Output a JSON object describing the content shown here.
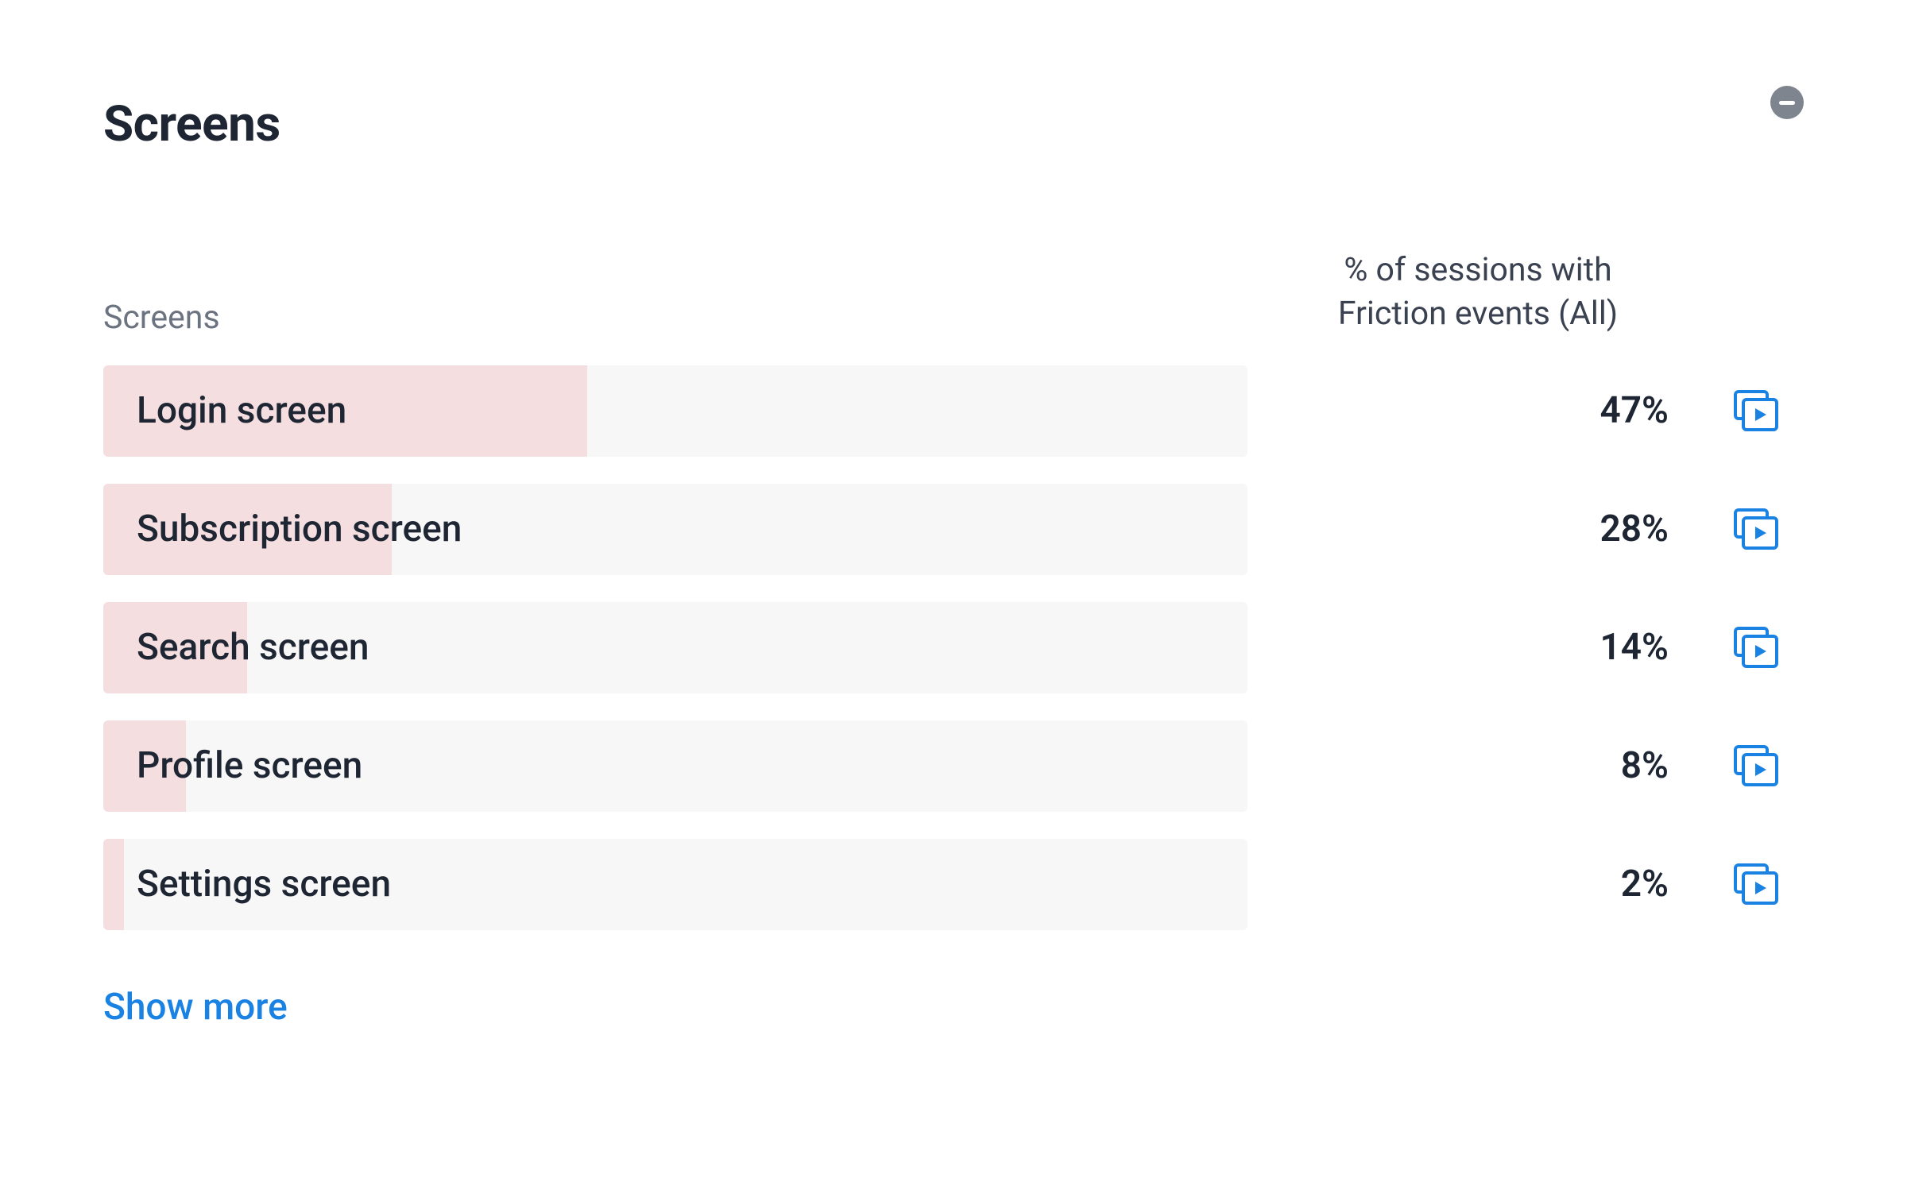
{
  "panel": {
    "title": "Screens",
    "columns": {
      "name_label": "Screens",
      "pct_label_line1": "% of sessions with",
      "pct_label_line2": "Friction events (All)"
    },
    "rows": [
      {
        "name": "Login screen",
        "pct_label": "47%",
        "pct": 47
      },
      {
        "name": "Subscription screen",
        "pct_label": "28%",
        "pct": 28
      },
      {
        "name": "Search screen",
        "pct_label": "14%",
        "pct": 14
      },
      {
        "name": "Profile screen",
        "pct_label": "8%",
        "pct": 8
      },
      {
        "name": "Settings screen",
        "pct_label": "2%",
        "pct": 2
      }
    ],
    "show_more_label": "Show more"
  },
  "colors": {
    "bar_track": "#f7f7f8",
    "bar_fill": "#f5dedf",
    "accent_link": "#1a82e2",
    "icon_blue": "#1a82e2",
    "text_primary": "#1f2633",
    "text_muted": "#6b7380",
    "collapse_bg": "#7e858f"
  },
  "chart_data": {
    "type": "bar",
    "title": "Screens",
    "xlabel": "",
    "ylabel": "% of sessions with Friction events (All)",
    "categories": [
      "Login screen",
      "Subscription screen",
      "Search screen",
      "Profile screen",
      "Settings screen"
    ],
    "values": [
      47,
      28,
      14,
      8,
      2
    ],
    "ylim": [
      0,
      100
    ]
  }
}
